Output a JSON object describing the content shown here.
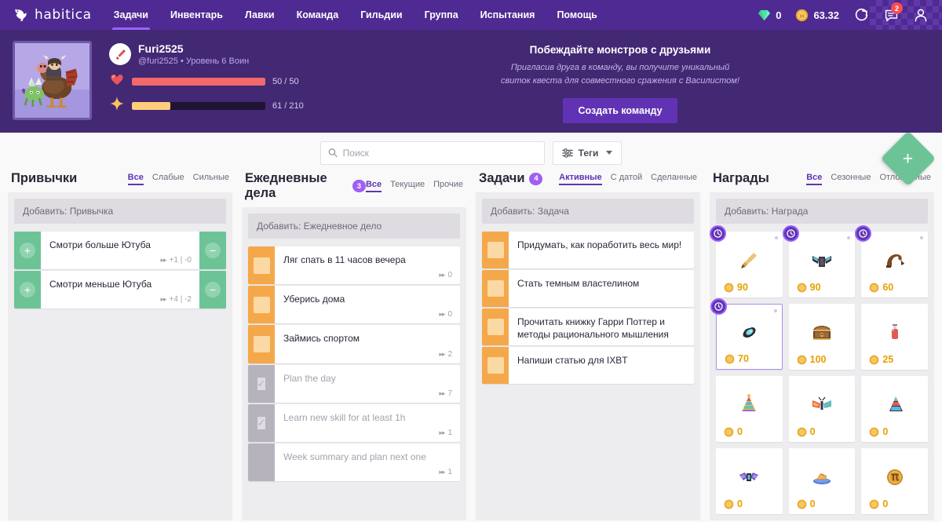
{
  "nav": {
    "brand": "habitica",
    "brand_icon": "gryphon-logo-icon",
    "items": [
      {
        "label": "Задачи",
        "active": true
      },
      {
        "label": "Инвентарь",
        "active": false
      },
      {
        "label": "Лавки",
        "active": false
      },
      {
        "label": "Команда",
        "active": false
      },
      {
        "label": "Гильдии",
        "active": false
      },
      {
        "label": "Группа",
        "active": false
      },
      {
        "label": "Испытания",
        "active": false
      },
      {
        "label": "Помощь",
        "active": false
      }
    ],
    "gems": "0",
    "gold": "63.32",
    "gem_icon": "gem-icon",
    "gold_icon": "gold-coin-icon",
    "sync_icon": "refresh-icon",
    "messages_icon": "messages-icon",
    "messages_badge": "2",
    "avatar_icon": "user-avatar-icon"
  },
  "profile": {
    "avatar_name": "avatar-display",
    "class_icon": "warrior-sword-icon",
    "display_name": "Furi2525",
    "subtitle": "@furi2525 • Уровень 6 Воин",
    "health": {
      "icon": "heart-icon",
      "label": "50 / 50",
      "value": 50,
      "max": 50,
      "color": "#f2696c"
    },
    "experience": {
      "icon": "star-icon",
      "label": "61 / 210",
      "value": 61,
      "max": 210,
      "color": "#ffbe5d"
    }
  },
  "promo": {
    "title": "Побеждайте монстров с друзьями",
    "line1": "Пригласив друга в команду, вы получите уникальный",
    "line2": "свиток квеста для совместного сражения с Василистом!",
    "button": "Создать команду"
  },
  "fab": {
    "icon": "plus-icon",
    "label": "+"
  },
  "search": {
    "icon": "search-icon",
    "placeholder": "Поиск",
    "value": "",
    "tags_label": "Теги",
    "tags_icon": "filter-sliders-icon",
    "caret_icon": "chevron-down-icon"
  },
  "columns": {
    "habits": {
      "title": "Привычки",
      "count": null,
      "filters": [
        {
          "label": "Все",
          "active": true
        },
        {
          "label": "Слабые",
          "active": false
        },
        {
          "label": "Сильные",
          "active": false
        }
      ],
      "add_placeholder": "Добавить: Привычка",
      "tasks": [
        {
          "title": "Смотри больше Ютуба",
          "meta": "+1 | -0",
          "plus": "+",
          "minus": "−"
        },
        {
          "title": "Смотри меньше Ютуба",
          "meta": "+4 | -2",
          "plus": "+",
          "minus": "−"
        }
      ]
    },
    "dailies": {
      "title": "Ежедневные дела",
      "count": "3",
      "filters": [
        {
          "label": "Все",
          "active": true
        },
        {
          "label": "Текущие",
          "active": false
        },
        {
          "label": "Прочие",
          "active": false
        }
      ],
      "add_placeholder": "Добавить: Ежедневное дело",
      "tasks": [
        {
          "title": "Ляг спать в 11 часов вечера",
          "meta": "0",
          "state": "active"
        },
        {
          "title": "Уберись дома",
          "meta": "0",
          "state": "active"
        },
        {
          "title": "Займись спортом",
          "meta": "2",
          "state": "active"
        },
        {
          "title": "Plan the day",
          "meta": "7",
          "state": "done"
        },
        {
          "title": "Learn new skill for at least 1h",
          "meta": "1",
          "state": "done"
        },
        {
          "title": "Week summary and plan next one",
          "meta": "1",
          "state": "grey"
        }
      ]
    },
    "todos": {
      "title": "Задачи",
      "count": "4",
      "filters": [
        {
          "label": "Активные",
          "active": true
        },
        {
          "label": "С датой",
          "active": false
        },
        {
          "label": "Сделанные",
          "active": false
        }
      ],
      "add_placeholder": "Добавить: Задача",
      "tasks": [
        {
          "title": "Придумать, как поработить весь мир!"
        },
        {
          "title": "Стать темным властелином"
        },
        {
          "title": "Прочитать книжку Гарри Поттер и методы рационального мышления"
        },
        {
          "title": "Напиши статью для IXBT"
        }
      ]
    },
    "rewards": {
      "title": "Награды",
      "count": null,
      "filters": [
        {
          "label": "Все",
          "active": true
        },
        {
          "label": "Сезонные",
          "active": false
        },
        {
          "label": "Отложенные",
          "active": false
        }
      ],
      "add_placeholder": "Добавить: Награда",
      "items": [
        {
          "icon": "sword-weapon-icon",
          "price": "90",
          "locked": true,
          "selected": false
        },
        {
          "icon": "armor-wings-icon",
          "price": "90",
          "locked": true,
          "selected": false
        },
        {
          "icon": "helmet-hat-icon",
          "price": "60",
          "locked": true,
          "selected": false
        },
        {
          "icon": "shield-icon",
          "price": "70",
          "locked": true,
          "selected": true
        },
        {
          "icon": "treasure-chest-icon",
          "price": "100",
          "locked": false,
          "selected": false
        },
        {
          "icon": "health-potion-icon",
          "price": "25",
          "locked": false,
          "selected": false
        },
        {
          "icon": "party-hat-icon",
          "price": "0",
          "locked": false,
          "selected": false
        },
        {
          "icon": "butterfly-icon",
          "price": "0",
          "locked": false,
          "selected": false
        },
        {
          "icon": "cone-hat-icon",
          "price": "0",
          "locked": false,
          "selected": false
        },
        {
          "icon": "crystal-icon",
          "price": "0",
          "locked": false,
          "selected": false
        },
        {
          "icon": "pie-slice-icon",
          "price": "0",
          "locked": false,
          "selected": false
        },
        {
          "icon": "pi-coin-icon",
          "price": "0",
          "locked": false,
          "selected": false
        }
      ]
    }
  }
}
